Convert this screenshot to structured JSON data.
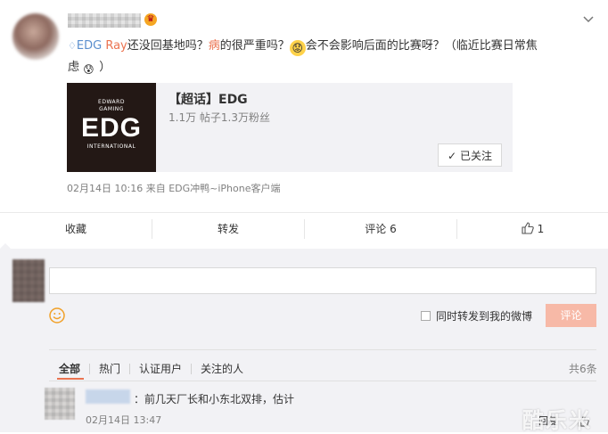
{
  "post": {
    "user_name_blurred": "",
    "author": "EDG",
    "mention": "Ray",
    "text_1": "还没回基地吗？",
    "text_highlight": "病",
    "text_2": "的很严重吗？",
    "text_3": "会不会影响后面的比赛呀？（临近比赛日常焦",
    "text_4": "虑",
    "text_5": "）",
    "timestamp": "02月14日 10:16",
    "via_prefix": "来自",
    "via": "EDG冲鸭~iPhone客户端"
  },
  "card": {
    "title": "【超话】EDG",
    "stats": "1.1万 帖子1.3万粉丝",
    "follow_label": "已关注",
    "logo_top_1": "EDWARD",
    "logo_top_2": "GAMING",
    "logo_main": "EDG",
    "logo_bottom": "INTERNATIONAL"
  },
  "actions": {
    "favorite": "收藏",
    "repost": "转发",
    "comment": "评论 6",
    "like_count": "1"
  },
  "compose": {
    "input_value": "",
    "also_repost_label": "同时转发到我的微博",
    "submit_label": "评论"
  },
  "comment_tabs": {
    "all": "全部",
    "hot": "热门",
    "verified": "认证用户",
    "following": "关注的人",
    "count": "共6条"
  },
  "comments": [
    {
      "text": "：前几天厂长和小东北双排，估计",
      "time": "02月14日 13:47",
      "reply": "回复"
    }
  ],
  "watermark": "酷乐米",
  "colors": {
    "accent": "#eb7350",
    "link_blue": "#5b8fce",
    "submit_bg": "#f7b9a7"
  }
}
